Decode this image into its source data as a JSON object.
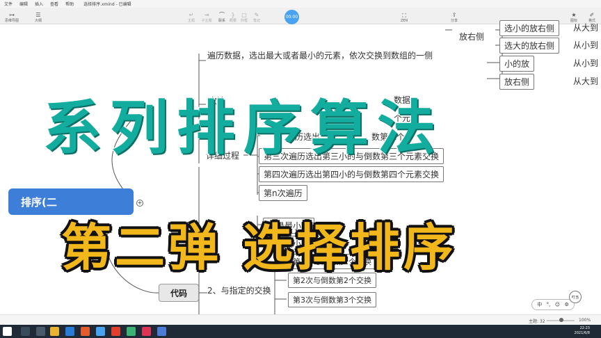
{
  "menubar": {
    "items": [
      "文件",
      "编辑",
      "插入",
      "查看",
      "帮助"
    ],
    "document_title": "选择排序.xmind - 已编辑"
  },
  "toolbar": {
    "left": [
      {
        "label": "思维导图",
        "icon": "mindmap-icon"
      },
      {
        "label": "大纲",
        "icon": "outline-icon"
      }
    ],
    "center": [
      {
        "label": "主题",
        "icon": "topic-icon",
        "enabled": false
      },
      {
        "label": "子主题",
        "icon": "subtopic-icon",
        "enabled": false
      },
      {
        "label": "联系",
        "icon": "relationship-icon",
        "enabled": true
      },
      {
        "label": "概要",
        "icon": "summary-icon",
        "enabled": false
      },
      {
        "label": "外框",
        "icon": "boundary-icon",
        "enabled": false
      },
      {
        "label": "笔记",
        "icon": "notes-icon",
        "enabled": false
      }
    ],
    "timer": "00:00",
    "zen_label": "ZEN",
    "share_label": "分享",
    "right": [
      {
        "label": "图标",
        "icon": "star-icon"
      },
      {
        "label": "格式",
        "icon": "brush-icon"
      }
    ]
  },
  "mindmap": {
    "root": "排序(二",
    "code_node": "代码",
    "placement_node": "放右侧",
    "right_options": [
      "选小的放右侧",
      "选大的放右侧",
      "小的放",
      "放右侧"
    ],
    "right_labels": [
      "从大到",
      "从小到",
      "从小到",
      "从大到"
    ],
    "traverse_text": "遍历数据，选出最大或者最小的元素，依次交换到数组的一侧",
    "first_pass_fragment": "次遍",
    "partial_nodes": [
      "数据",
      "个元",
      "历选出",
      "数第二个"
    ],
    "detail_label": "详细过程",
    "detail_steps": [
      "第三次遍历选出第三小的与倒数第三个元素交换",
      "第四次遍历选出第四小的与倒数第四个元素交换",
      "第n次遍历"
    ],
    "record_items": [
      "记录最小下",
      "记录最小数"
    ],
    "swap_label": "2、与指定的交换",
    "swap_steps": [
      "第1次与倒数第1个交换",
      "第2次与倒数第2个交换",
      "第3次与倒数第3个交换"
    ],
    "collapse_signs": [
      "+"
    ]
  },
  "overlay": {
    "title": "系列排序算法",
    "subtitle": "第二弹  选择排序"
  },
  "widget": {
    "ime_items": [
      "中",
      "°,",
      "☺",
      "⚙"
    ],
    "mascot": "叮当"
  },
  "statusbar": {
    "topics_label": "主题: 32",
    "zoom": "100%"
  },
  "taskbar": {
    "time": "22:23",
    "date": "2021/6/8"
  },
  "colors": {
    "root_fill": "#3d7ed8",
    "title_color": "#13ad9f",
    "subtitle_color": "#f2b81b",
    "timer": "#4aa3f0"
  }
}
